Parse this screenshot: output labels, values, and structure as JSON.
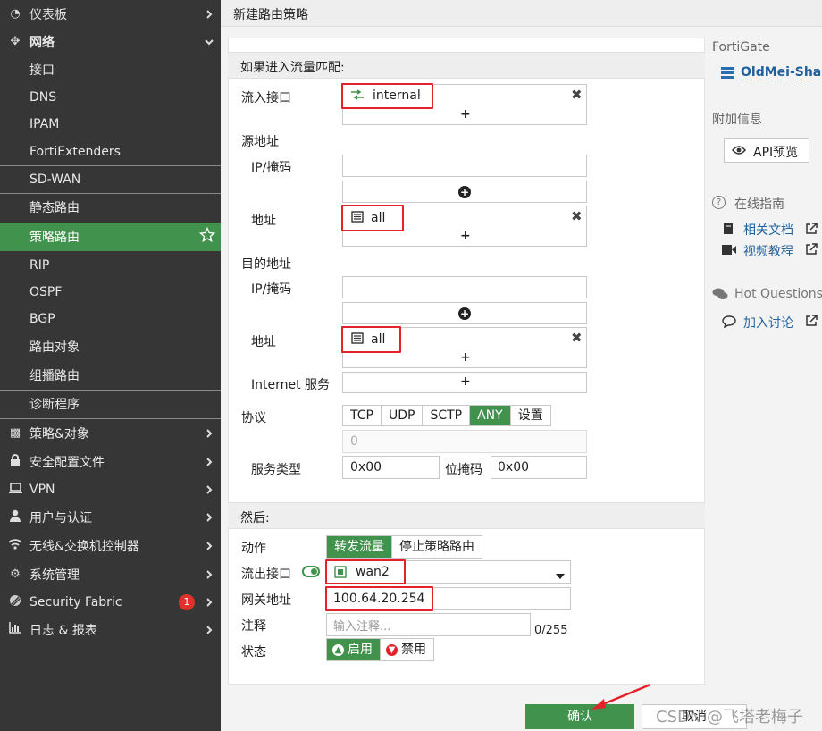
{
  "sidebar": {
    "items": [
      {
        "label": "仪表板",
        "icon": "dashboard-icon"
      },
      {
        "label": "网络",
        "icon": "network-arrows-icon"
      },
      {
        "label": "接口"
      },
      {
        "label": "DNS"
      },
      {
        "label": "IPAM"
      },
      {
        "label": "FortiExtenders"
      },
      {
        "label": "SD-WAN"
      },
      {
        "label": "静态路由"
      },
      {
        "label": "策略路由"
      },
      {
        "label": "RIP"
      },
      {
        "label": "OSPF"
      },
      {
        "label": "BGP"
      },
      {
        "label": "路由对象"
      },
      {
        "label": "组播路由"
      },
      {
        "label": "诊断程序"
      },
      {
        "label": "策略&对象",
        "icon": "policy-icon"
      },
      {
        "label": "安全配置文件",
        "icon": "lock-icon"
      },
      {
        "label": "VPN",
        "icon": "laptop-icon"
      },
      {
        "label": "用户与认证",
        "icon": "user-icon"
      },
      {
        "label": "无线&交换机控制器",
        "icon": "wifi-icon"
      },
      {
        "label": "系统管理",
        "icon": "gear-icon"
      },
      {
        "label": "Security Fabric",
        "icon": "fabric-icon",
        "badge": "1"
      },
      {
        "label": "日志 & 报表",
        "icon": "chart-icon"
      }
    ]
  },
  "header": {
    "title": "新建路由策略"
  },
  "form": {
    "match_section": "如果进入流量匹配:",
    "incoming_label": "流入接口",
    "incoming_value": "internal",
    "source_label": "源地址",
    "ipmask_label": "IP/掩码",
    "address_label": "地址",
    "src_address_value": "all",
    "dest_label": "目的地址",
    "dest_ipmask_label": "IP/掩码",
    "dest_address_label": "地址",
    "dst_address_value": "all",
    "internet_service_label": "Internet 服务",
    "protocol_label": "协议",
    "protocols": [
      "TCP",
      "UDP",
      "SCTP",
      "ANY",
      "设置"
    ],
    "protocol_number": "0",
    "service_type_label": "服务类型",
    "service_type_value": "0x00",
    "bitmask_label": "位掩码",
    "bitmask_value": "0x00",
    "then_section": "然后:",
    "action_label": "动作",
    "action_forward": "转发流量",
    "action_stop": "停止策略路由",
    "outgoing_label": "流出接口",
    "outgoing_value": "wan2",
    "gateway_label": "网关地址",
    "gateway_value": "100.64.20.254",
    "comment_label": "注释",
    "comment_placeholder": "输入注释...",
    "comment_counter": "0/255",
    "status_label": "状态",
    "status_enable": "启用",
    "status_disable": "禁用"
  },
  "footer": {
    "ok": "确认",
    "cancel": "取消",
    "watermark": "CSDN @飞塔老梅子"
  },
  "right": {
    "device_label": "FortiGate",
    "device_name": "OldMei-Shang",
    "extra_info": "附加信息",
    "api_preview": "API预览",
    "online_guide": "在线指南",
    "related_docs": "相关文档",
    "video_tutorial": "视频教程",
    "hot_questions": "Hot Questions",
    "join_discussion": "加入讨论"
  },
  "colors": {
    "accent": "#40924c",
    "sidebar": "#363636",
    "highlight_border": "#e3222a",
    "link": "#22609c"
  }
}
